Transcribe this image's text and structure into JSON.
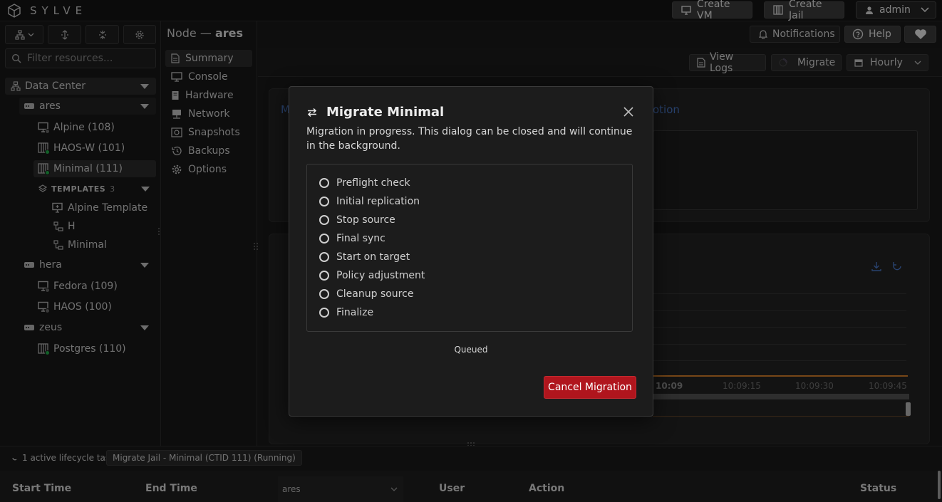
{
  "app": {
    "logo_text": "SYLVE"
  },
  "topbar": {
    "create_vm": "Create VM",
    "create_jail": "Create Jail",
    "user": "admin"
  },
  "header": {
    "notifications": "Notifications",
    "help": "Help"
  },
  "sidebar": {
    "filter_placeholder": "Filter resources...",
    "datacenter": "Data Center",
    "nodes": [
      {
        "name": "ares",
        "items": [
          "Alpine (108)",
          "HAOS-W (101)",
          "Minimal (111)"
        ]
      },
      {
        "name": "hera",
        "items": [
          "Fedora (109)",
          "HAOS (100)"
        ]
      },
      {
        "name": "zeus",
        "items": [
          "Postgres (110)"
        ]
      }
    ],
    "templates_label": "TEMPLATES",
    "templates_count": "3",
    "templates": [
      "Alpine Template",
      "H",
      "Minimal"
    ]
  },
  "node": {
    "prefix": "Node —",
    "name": "ares"
  },
  "nav": {
    "items": [
      "Summary",
      "Console",
      "Hardware",
      "Network",
      "Snapshots",
      "Backups",
      "Options"
    ],
    "active": "Summary"
  },
  "toolbar": {
    "view_logs": "View Logs",
    "migrate": "Migrate",
    "interval": "Hourly"
  },
  "background": {
    "peek_left": "M",
    "peek_right": "otion",
    "ticks": [
      "10:09",
      "10:09:15",
      "10:09:30",
      "10:09:45"
    ]
  },
  "taskbar": {
    "active": "1 active lifecycle task",
    "task": "Migrate Jail - Minimal (CTID 111) (Running)"
  },
  "table": {
    "headers": [
      "Start Time",
      "End Time",
      "User",
      "Action",
      "Status"
    ],
    "filter_value": "ares"
  },
  "modal": {
    "title": "Migrate Minimal",
    "description": "Migration in progress. This dialog can be closed and will continue in the background.",
    "steps": [
      "Preflight check",
      "Initial replication",
      "Stop source",
      "Final sync",
      "Start on target",
      "Policy adjustment",
      "Cleanup source",
      "Finalize"
    ],
    "status": "Queued",
    "cancel": "Cancel Migration"
  },
  "colors": {
    "accent_red": "#b0151d",
    "status_green": "#22b04a",
    "link_blue": "#4a78c8",
    "chart_orange": "#d9822b"
  }
}
